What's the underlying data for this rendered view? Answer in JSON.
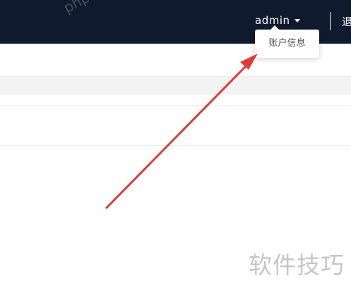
{
  "header": {
    "username": "admin",
    "logout_label": "退"
  },
  "dropdown": {
    "items": [
      {
        "label": "账户信息"
      }
    ]
  },
  "annotation": {
    "arrow_color": "#e23a3a",
    "arrow_icon": "red-arrow-icon"
  },
  "watermarks": {
    "top": "php.cn",
    "bottom": "软件技巧"
  },
  "colors": {
    "topbar": "#0f1a2e",
    "dropdown_text": "#555555"
  }
}
